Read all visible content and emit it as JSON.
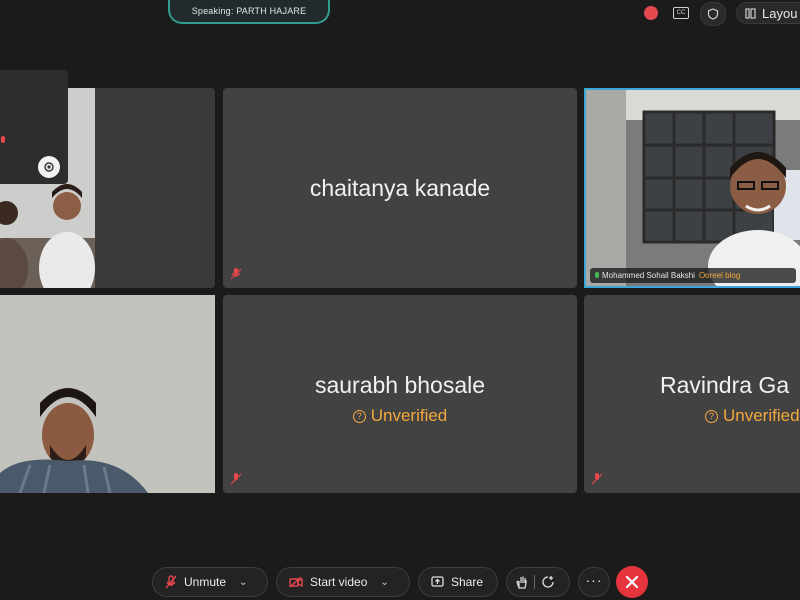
{
  "top_bar": {
    "speaking_label": "Speaking: PARTH HAJARE",
    "layout_label": "Layou"
  },
  "tiles": {
    "chaitanya": {
      "name": "chaitanya kanade"
    },
    "saurabh": {
      "name": "saurabh bhosale",
      "status": "Unverified"
    },
    "ravindra": {
      "name": "Ravindra Ga",
      "status": "Unverified"
    },
    "mohammed": {
      "name": "Mohammed Sohail Bakshi",
      "tag": "Ooreel blog"
    }
  },
  "toolbar": {
    "unmute_label": "Unmute",
    "start_video_label": "Start video",
    "share_label": "Share"
  },
  "colors": {
    "accent_speaking": "#2f9e8f",
    "unverified": "#f3a93b",
    "end_call": "#e5343c",
    "active_border": "#3aa7d8"
  },
  "icons": [
    "record-icon",
    "captions-icon",
    "shield-icon",
    "layout-icon",
    "mic-muted-icon",
    "camera-off-icon",
    "share-screen-icon",
    "raise-hand-icon",
    "reactions-icon",
    "more-icon",
    "end-call-icon"
  ]
}
